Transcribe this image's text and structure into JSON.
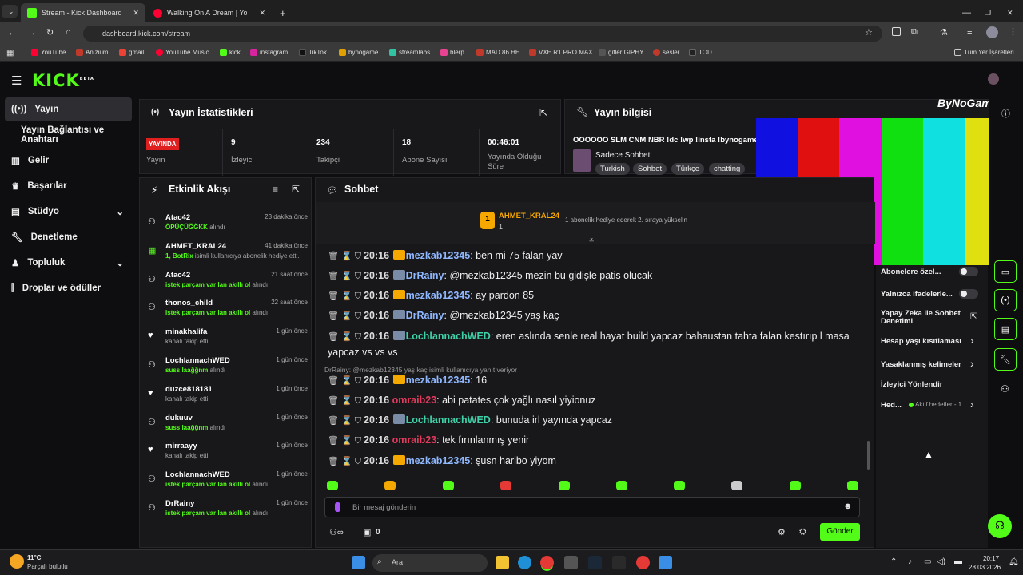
{
  "browser": {
    "tabs": [
      {
        "title": "Stream - Kick Dashboard"
      },
      {
        "title": "Walking On A Dream | YouT"
      }
    ],
    "url": "dashboard.kick.com/stream"
  },
  "bookmarks": [
    "YouTube",
    "Anizium",
    "gmail",
    "YouTube Music",
    "kick",
    "instagram",
    "TikTok",
    "bynogame",
    "streamlabs",
    "blerp",
    "MAD 86 HE",
    "VXE R1 PRO MAX",
    "gifler GIPHY",
    "sesler",
    "TOD"
  ],
  "bookmarks_all": "Tüm Yer İşaretleri",
  "logo": "KICK",
  "logo_sup": "BETA",
  "sidebar": {
    "items": [
      {
        "label": "Yayın"
      },
      {
        "label": "Yayın Bağlantısı ve Anahtarı"
      },
      {
        "label": "Gelir"
      },
      {
        "label": "Başarılar"
      },
      {
        "label": "Stüdyo"
      },
      {
        "label": "Denetleme"
      },
      {
        "label": "Topluluk"
      },
      {
        "label": "Droplar ve ödüller"
      }
    ]
  },
  "stats": {
    "title": "Yayın İstatistikleri",
    "live_badge": "YAYINDA",
    "live_label": "Yayın",
    "items": [
      {
        "value": "9",
        "label": "İzleyici"
      },
      {
        "value": "234",
        "label": "Takipçi"
      },
      {
        "value": "18",
        "label": "Abone Sayısı"
      },
      {
        "value": "00:46:01",
        "label": "Yayında Olduğu Süre"
      }
    ]
  },
  "info": {
    "title": "Yayın bilgisi",
    "stream_title": "OOOOOO SLM CNM NBR !dc !wp !insta !bynogame",
    "category": "Sadece Sohbet",
    "tags": [
      "Turkish",
      "Sohbet",
      "Türkçe",
      "chatting"
    ],
    "brand": "ByNoGame"
  },
  "activity": {
    "title": "Etkinlik Akışı",
    "items": [
      {
        "user": "Atac42",
        "time": "23 dakika önce",
        "pre": "",
        "highlight": "ÖPÜÇÜĞĞKK",
        "post": " alındı"
      },
      {
        "user": "AHMET_KRAL24",
        "time": "41 dakika önce",
        "pre": "",
        "highlight": "1, BotRix",
        "post": " isimli kullanıcıya abonelik hediye etti."
      },
      {
        "user": "Atac42",
        "time": "21 saat önce",
        "pre": "",
        "highlight": "istek parçam var lan akıllı ol",
        "post": " alındı"
      },
      {
        "user": "thonos_child",
        "time": "22 saat önce",
        "pre": "",
        "highlight": "istek parçam var lan akıllı ol",
        "post": " alındı"
      },
      {
        "user": "minakhalifa",
        "time": "1 gün önce",
        "pre": "kanalı takip etti",
        "highlight": "",
        "post": ""
      },
      {
        "user": "LochlannachWED",
        "time": "1 gün önce",
        "pre": "",
        "highlight": "suss laağğnm",
        "post": " alındı"
      },
      {
        "user": "duzce818181",
        "time": "1 gün önce",
        "pre": "kanalı takip etti",
        "highlight": "",
        "post": ""
      },
      {
        "user": "dukuuv",
        "time": "1 gün önce",
        "pre": "",
        "highlight": "suss laağğnm",
        "post": " alındı"
      },
      {
        "user": "mirraayy",
        "time": "1 gün önce",
        "pre": "kanalı takip etti",
        "highlight": "",
        "post": ""
      },
      {
        "user": "LochlannachWED",
        "time": "1 gün önce",
        "pre": "",
        "highlight": "istek parçam var lan akıllı ol",
        "post": " alındı"
      },
      {
        "user": "DrRainy",
        "time": "1 gün önce",
        "pre": "",
        "highlight": "istek parçam var lan akıllı ol",
        "post": " alındı"
      }
    ]
  },
  "chat": {
    "title": "Sohbet",
    "pinned_user": "AHMET_KRAL24",
    "pinned_rank": "1",
    "pinned_count": "1",
    "pinned_note": "1 abonelik hediye ederek 2. sıraya yükselin",
    "messages": [
      {
        "time": "20:16",
        "user": "mezkab12345",
        "text": ": ben mi 75 falan yav",
        "color": "#8fb8ff",
        "badge": "crown"
      },
      {
        "time": "20:16",
        "user": "DrRainy",
        "text": ": @mezkab12345 mezin bu gidişle patis olucak",
        "color": "#8fb8ff",
        "badge": "av"
      },
      {
        "time": "20:16",
        "user": "mezkab12345",
        "text": ": ay pardon 85",
        "color": "#8fb8ff",
        "badge": "crown"
      },
      {
        "time": "20:16",
        "user": "DrRainy",
        "text": ": @mezkab12345 yaş kaç",
        "color": "#8fb8ff",
        "badge": "av"
      },
      {
        "time": "20:16",
        "user": "LochlannachWED",
        "text": ": eren aslında senle real hayat build yapcaz bahaustan tahta falan kestırıp l masa yapcaz vs vs vs",
        "color": "#3fd1a8",
        "badge": "av"
      },
      {
        "time": "20:16",
        "user": "mezkab12345",
        "text": ": 16",
        "color": "#8fb8ff",
        "badge": "crown"
      },
      {
        "time": "20:16",
        "user": "omraib23",
        "text": ": abi patates çok yağlı nasıl yiyionuz",
        "color": "#e23a5c",
        "badge": ""
      },
      {
        "time": "20:16",
        "user": "LochlannachWED",
        "text": ": bunuda irl yayında yapcaz",
        "color": "#3fd1a8",
        "badge": "av"
      },
      {
        "time": "20:16",
        "user": "omraib23",
        "text": ": tek fırınlanmış yenir",
        "color": "#e23a5c",
        "badge": ""
      },
      {
        "time": "20:16",
        "user": "mezkab12345",
        "text": ": şusn haribo yiyom",
        "color": "#8fb8ff",
        "badge": "crown"
      }
    ],
    "reply_note": "DrRainy: @mezkab12345 yaş kaç isimli kullanıcıya yanıt veriyor",
    "input_placeholder": "Bir mesaj gönderin",
    "points": "0",
    "send": "Gönder"
  },
  "right_panel": {
    "items": [
      {
        "label": "Abonelere özel..."
      },
      {
        "label": "Yalnızca ifadelerle..."
      },
      {
        "label": "Yapay Zeka ile Sohbet Denetimi"
      },
      {
        "label": "Hesap yaşı kısıtlaması"
      },
      {
        "label": "Yasaklanmış kelimeler"
      },
      {
        "label": "İzleyici Yönlendir"
      },
      {
        "label": "Hed..."
      }
    ],
    "goals": "Aktif hedefler - 1"
  },
  "taskbar": {
    "temp": "11°C",
    "weather": "Parçalı bulutlu",
    "search": "Ara",
    "time": "20:17",
    "date": "28.03.2026"
  },
  "colors": {
    "accent": "#53fc18",
    "bg": "#0e0e10",
    "panel": "#18181b",
    "live": "#e01f1f"
  }
}
